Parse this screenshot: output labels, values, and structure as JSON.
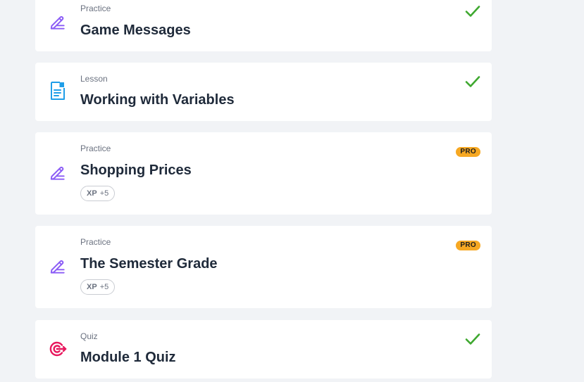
{
  "items": [
    {
      "kind": "Practice",
      "title": "Game Messages",
      "icon": "pencil-practice-icon",
      "status": "completed"
    },
    {
      "kind": "Lesson",
      "title": "Working with Variables",
      "icon": "lesson-document-icon",
      "status": "completed"
    },
    {
      "kind": "Practice",
      "title": "Shopping Prices",
      "icon": "pencil-practice-icon",
      "status": "pro",
      "badge": "PRO",
      "xp_label": "XP",
      "xp_value": "+5"
    },
    {
      "kind": "Practice",
      "title": "The Semester Grade",
      "icon": "pencil-practice-icon",
      "status": "pro",
      "badge": "PRO",
      "xp_label": "XP",
      "xp_value": "+5"
    },
    {
      "kind": "Quiz",
      "title": "Module 1 Quiz",
      "icon": "quiz-target-icon",
      "status": "completed"
    }
  ],
  "colors": {
    "practice_icon": "#8b5cf6",
    "lesson_icon": "#1f9ee8",
    "quiz_icon": "#e8175d",
    "check": "#3ea82f",
    "pro_badge": "#f6a823",
    "background": "#f1f3f6"
  }
}
